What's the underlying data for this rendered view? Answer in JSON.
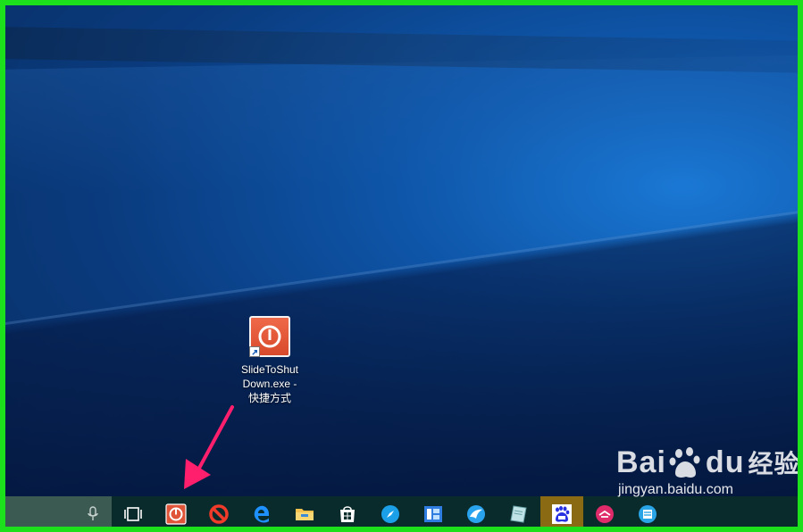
{
  "desktop": {
    "shortcut": {
      "label_lines": [
        "SlideToShut",
        "Down.exe -",
        "快捷方式"
      ],
      "icon": "power-icon"
    }
  },
  "watermark": {
    "brand_left": "Bai",
    "brand_mid": "du",
    "brand_right": "经验",
    "url": "jingyan.baidu.com"
  },
  "taskbar": {
    "items": [
      {
        "name": "task-view-icon"
      },
      {
        "name": "slide-to-shutdown-icon"
      },
      {
        "name": "block-icon"
      },
      {
        "name": "edge-icon"
      },
      {
        "name": "file-explorer-icon"
      },
      {
        "name": "store-icon"
      },
      {
        "name": "browser-compass-icon"
      },
      {
        "name": "app-blue-icon"
      },
      {
        "name": "bird-app-icon"
      },
      {
        "name": "notepad-app-icon"
      },
      {
        "name": "baidu-icon"
      },
      {
        "name": "pink-app-icon"
      },
      {
        "name": "kan-app-icon"
      }
    ]
  },
  "colors": {
    "frame": "#1be01b",
    "taskbar": "#0a2b2c",
    "accent_arrow": "#ff1f6d"
  }
}
